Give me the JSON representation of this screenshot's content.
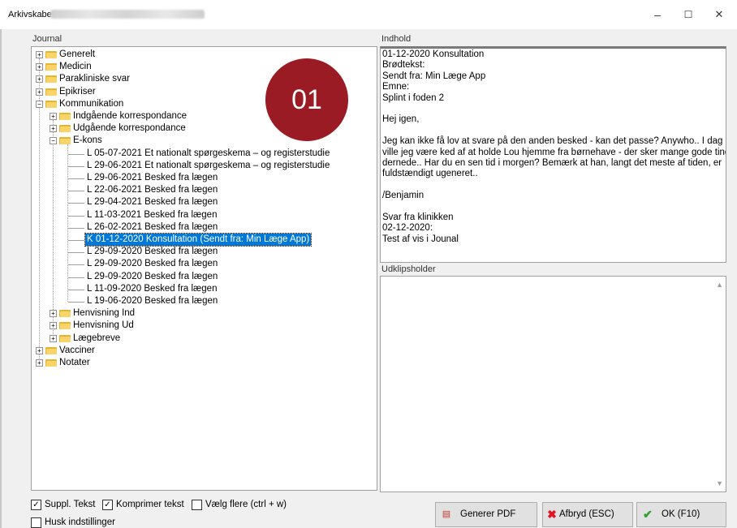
{
  "window": {
    "title": "Arkivskabet -",
    "controls": {
      "minimize": "–",
      "maximize": "☐",
      "close": "✕"
    }
  },
  "journal": {
    "label": "Journal",
    "tree": [
      {
        "label": "Generelt",
        "expander": "+"
      },
      {
        "label": "Medicin",
        "expander": "+"
      },
      {
        "label": "Parakliniske svar",
        "expander": "+"
      },
      {
        "label": "Epikriser",
        "expander": "+"
      },
      {
        "label": "Kommunikation",
        "expander": "−"
      },
      {
        "label": "Indgående korrespondance",
        "expander": "+"
      },
      {
        "label": "Udgående korrespondance",
        "expander": "+"
      },
      {
        "label": "E-kons",
        "expander": "−"
      },
      {
        "label": "L 05-07-2021 Et nationalt spørgeskema – og registerstudie"
      },
      {
        "label": "L 29-06-2021 Et nationalt spørgeskema – og registerstudie"
      },
      {
        "label": "L 29-06-2021 Besked fra lægen"
      },
      {
        "label": "L 22-06-2021 Besked fra lægen"
      },
      {
        "label": "L 29-04-2021 Besked fra lægen"
      },
      {
        "label": "L 11-03-2021 Besked fra lægen"
      },
      {
        "label": "L 26-02-2021 Besked fra lægen"
      },
      {
        "label": "K 01-12-2020 Konsultation (Sendt fra: Min Læge App)"
      },
      {
        "label": "L 29-09-2020 Besked fra lægen"
      },
      {
        "label": "L 29-09-2020 Besked fra lægen"
      },
      {
        "label": "L 29-09-2020 Besked fra lægen"
      },
      {
        "label": "L 11-09-2020 Besked fra lægen"
      },
      {
        "label": "L 19-06-2020 Besked fra lægen"
      },
      {
        "label": "Henvisning Ind",
        "expander": "+"
      },
      {
        "label": "Henvisning Ud",
        "expander": "+"
      },
      {
        "label": "Lægebreve",
        "expander": "+"
      },
      {
        "label": "Vacciner",
        "expander": "+"
      },
      {
        "label": "Notater",
        "expander": "+"
      }
    ]
  },
  "badge": {
    "text": "01",
    "color": "#9b1b24"
  },
  "content": {
    "label": "Indhold",
    "lines": [
      "01-12-2020 Konsultation",
      "Brødtekst:",
      "Sendt fra: Min Læge App",
      "Emne:",
      "Splint i foden 2",
      "",
      "Hej igen,",
      "",
      "Jeg kan ikke få lov at svare på den anden besked - kan det passe? Anywho.. I dag",
      "ville jeg være ked af at holde Lou hjemme fra børnehave - der sker mange gode ting",
      "dernede.. Har du en sen tid i morgen? Bemærk at han, langt det meste af tiden, er",
      "fuldstændigt ugeneret..",
      "",
      "/Benjamin",
      "",
      "Svar fra klinikken",
      "02-12-2020:",
      "Test af vis i Jounal"
    ]
  },
  "clipboard": {
    "label": "Udklipsholder",
    "value": ""
  },
  "options": {
    "suppl_tekst": {
      "label": "Suppl. Tekst",
      "checked": true
    },
    "komprimer_tekst": {
      "label": "Komprimer tekst",
      "checked": true
    },
    "vaelg_flere": {
      "label": "Vælg flere (ctrl + w)",
      "checked": false
    },
    "husk_indstillinger": {
      "label": "Husk indstillinger",
      "checked": false
    }
  },
  "buttons": {
    "pdf": {
      "label": "Generer PDF",
      "icon": "pdf-icon"
    },
    "cancel": {
      "label": "Afbryd (ESC)",
      "icon": "red-x-icon"
    },
    "ok": {
      "label": "OK (F10)",
      "icon": "green-check-icon"
    }
  },
  "colors": {
    "selection": "#0078d7",
    "folder": "#f8d46a",
    "cancel_icon": "#e81123",
    "ok_icon": "#2e9e2e"
  }
}
